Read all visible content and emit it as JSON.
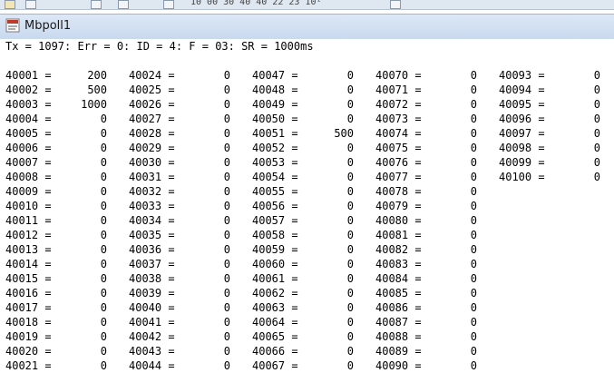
{
  "toolbar": {
    "items_text": "10  00  30  40  40  22  23   10¹",
    "icons": [
      "page-icon",
      "save-icon",
      "cut-icon",
      "blank-icon",
      "print-icon",
      "help-icon"
    ]
  },
  "window": {
    "title": "Mbpoll1",
    "icon": "mbpoll-app-icon"
  },
  "status_line": "Tx = 1097: Err = 0: ID = 4: F = 03: SR = 1000ms",
  "registers": {
    "columns": [
      {
        "start": 40001,
        "values": [
          200,
          500,
          1000,
          0,
          0,
          0,
          0,
          0,
          0,
          0,
          0,
          0,
          0,
          0,
          0,
          0,
          0,
          0,
          0,
          0,
          0
        ]
      },
      {
        "start": 40024,
        "values": [
          0,
          0,
          0,
          0,
          0,
          0,
          0,
          0,
          0,
          0,
          0,
          0,
          0,
          0,
          0,
          0,
          0,
          0,
          0,
          0,
          0
        ]
      },
      {
        "start": 40047,
        "values": [
          0,
          0,
          0,
          0,
          500,
          0,
          0,
          0,
          0,
          0,
          0,
          0,
          0,
          0,
          0,
          0,
          0,
          0,
          0,
          0,
          0
        ]
      },
      {
        "start": 40070,
        "values": [
          0,
          0,
          0,
          0,
          0,
          0,
          0,
          0,
          0,
          0,
          0,
          0,
          0,
          0,
          0,
          0,
          0,
          0,
          0,
          0,
          0
        ]
      },
      {
        "start": 40093,
        "values": [
          0,
          0,
          0,
          0,
          0,
          0,
          0,
          0
        ]
      }
    ]
  }
}
